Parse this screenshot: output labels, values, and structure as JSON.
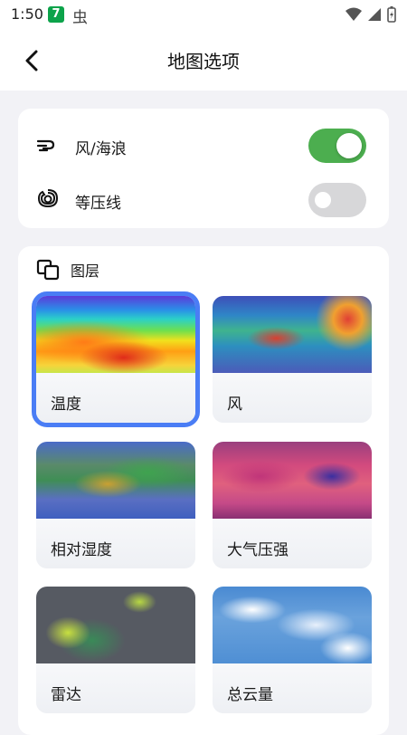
{
  "status_bar": {
    "time": "1:50",
    "app_icon_1": "7",
    "app_icon_2": "虫"
  },
  "nav": {
    "title": "地图选项",
    "back_icon": "chevron-left-icon"
  },
  "toggles": [
    {
      "icon": "wind-waves-icon",
      "label": "风/海浪",
      "enabled": true
    },
    {
      "icon": "isobar-icon",
      "label": "等压线",
      "enabled": false
    }
  ],
  "layers": {
    "header_icon": "layers-icon",
    "title": "图层",
    "items": [
      {
        "label": "温度",
        "selected": true
      },
      {
        "label": "风",
        "selected": false
      },
      {
        "label": "相对湿度",
        "selected": false
      },
      {
        "label": "大气压强",
        "selected": false
      },
      {
        "label": "雷达",
        "selected": false
      },
      {
        "label": "总云量",
        "selected": false
      }
    ]
  },
  "colors": {
    "accent_selected": "#4a7df5",
    "switch_on": "#4cae4f",
    "switch_off": "#d7d7d9"
  }
}
